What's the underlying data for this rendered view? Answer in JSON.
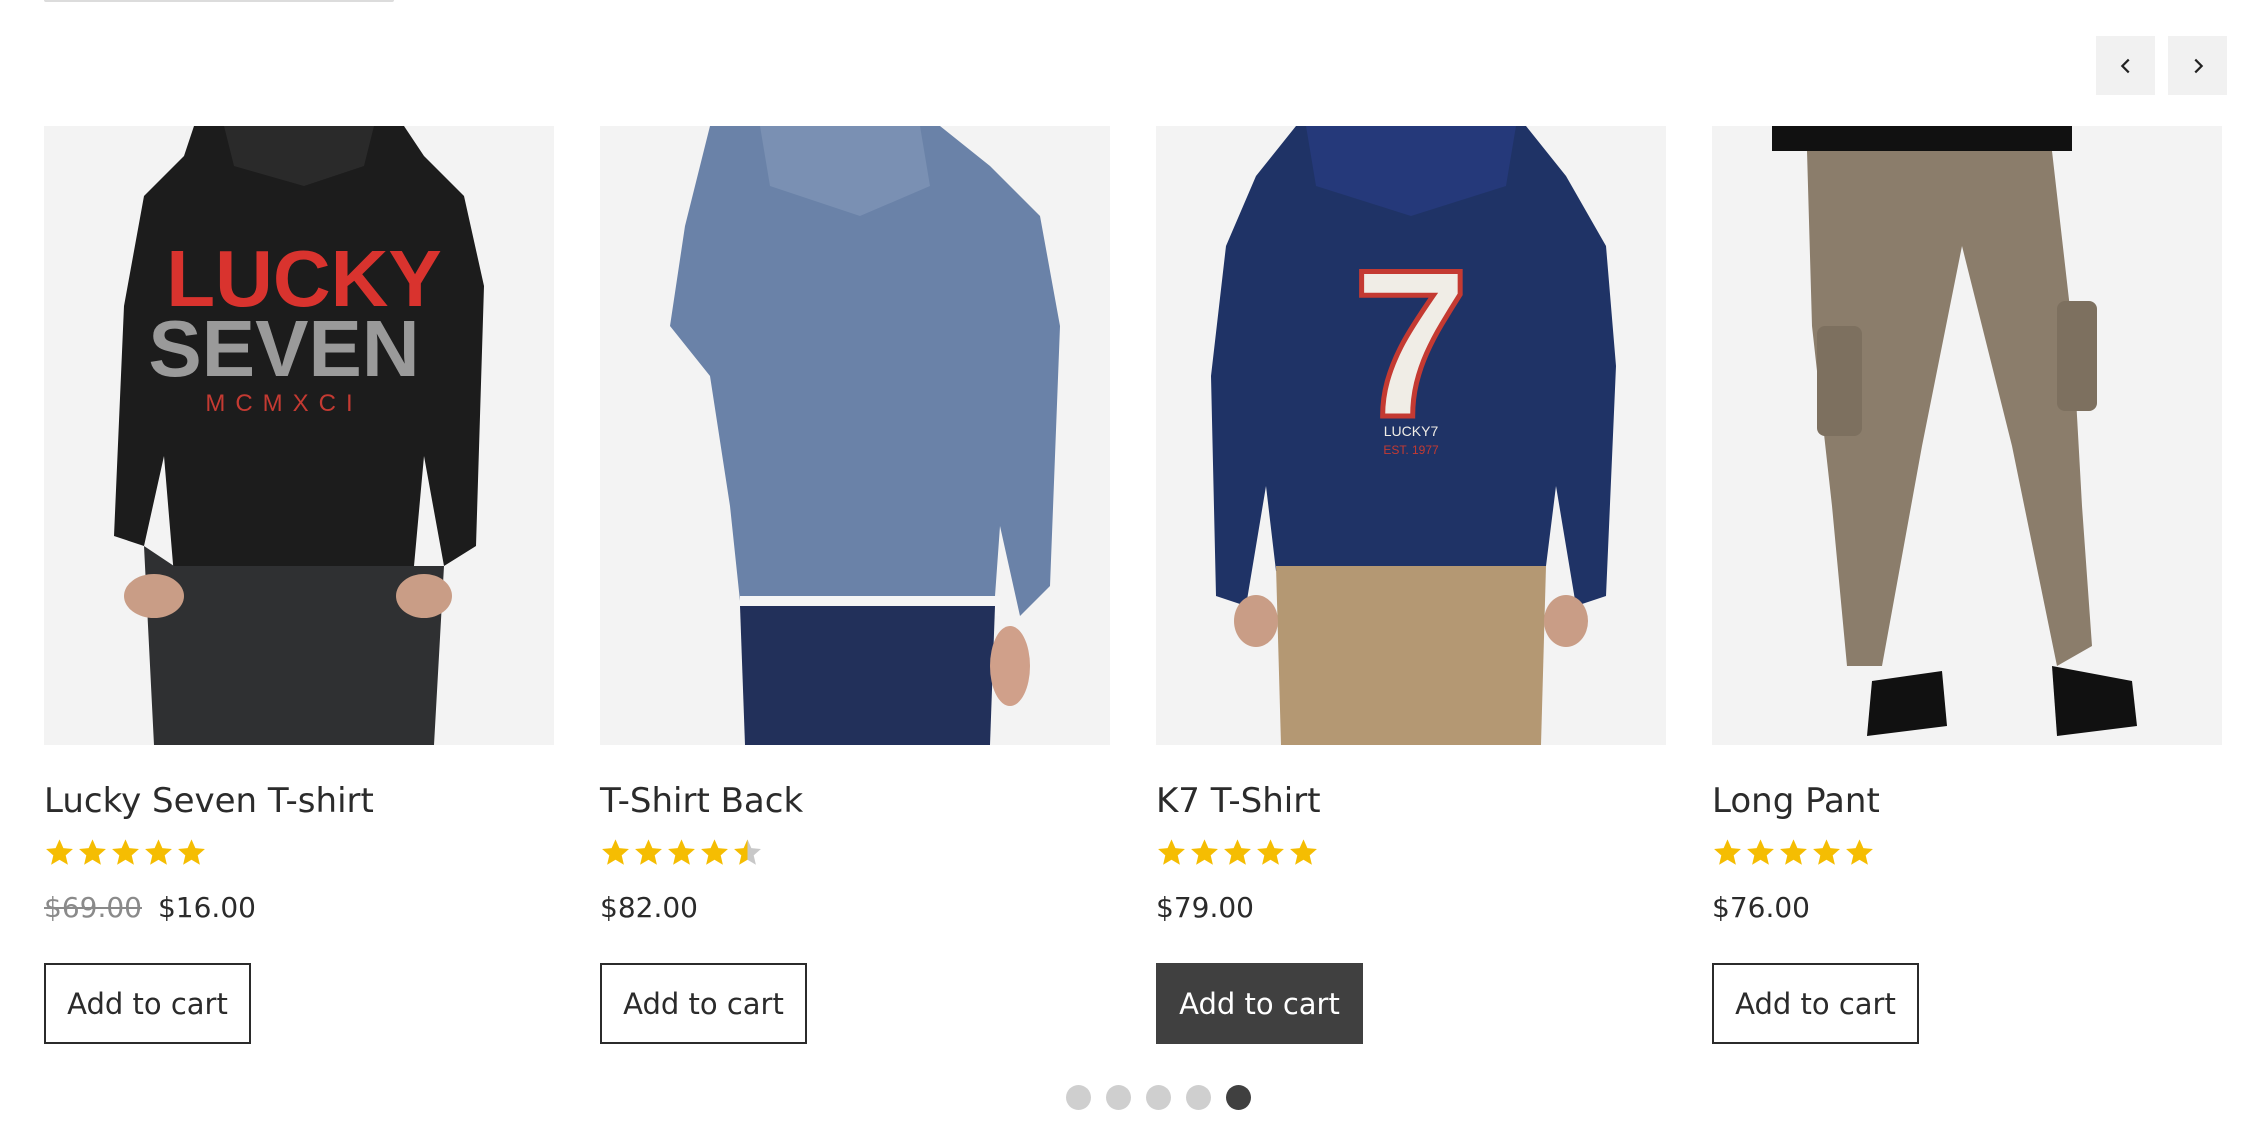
{
  "navigation": {
    "prev_icon": "chevron-left-icon",
    "next_icon": "chevron-right-icon"
  },
  "products": [
    {
      "name": "Lucky Seven T-shirt",
      "rating": 5,
      "old_price": "$69.00",
      "price": "$16.00",
      "button_label": "Add to cart",
      "image_alt_text": [
        "LUCKY",
        "SEVEN",
        "MCMXCI"
      ]
    },
    {
      "name": "T-Shirt Back",
      "rating": 4.5,
      "old_price": "",
      "price": "$82.00",
      "button_label": "Add to cart",
      "image_alt_text": []
    },
    {
      "name": "K7 T-Shirt",
      "rating": 5,
      "old_price": "",
      "price": "$79.00",
      "button_label": "Add to cart",
      "image_alt_text": [
        "7",
        "LUCKY7",
        "EST. 1977"
      ]
    },
    {
      "name": "Long Pant",
      "rating": 5,
      "old_price": "",
      "price": "$76.00",
      "button_label": "Add to cart",
      "image_alt_text": []
    }
  ],
  "pagination": {
    "total": 5,
    "active_index": 4
  },
  "colors": {
    "star": "#f5bd02",
    "star_empty": "#c8c8c8",
    "active_button": "#404040"
  }
}
